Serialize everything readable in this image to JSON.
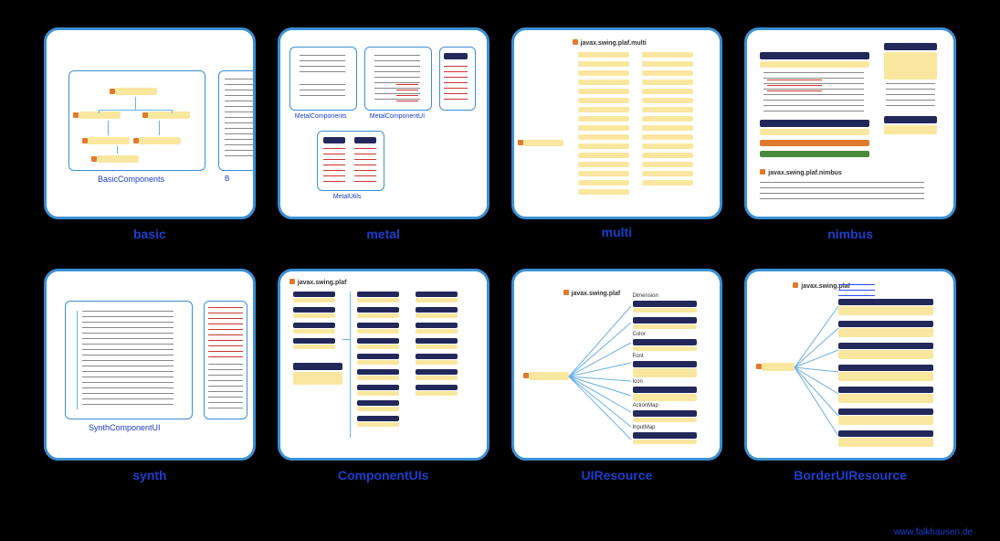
{
  "cards": [
    {
      "id": "basic",
      "label": "basic",
      "inner_label": "BasicComponents"
    },
    {
      "id": "metal",
      "label": "metal",
      "inner_labels": [
        "MetalComponents",
        "MetalComponentUI",
        "MetalUtils"
      ]
    },
    {
      "id": "multi",
      "label": "multi",
      "package": "javax.swing.plaf.multi"
    },
    {
      "id": "nimbus",
      "label": "nimbus",
      "package": "javax.swing.plaf.nimbus"
    },
    {
      "id": "synth",
      "label": "synth",
      "inner_label": "SynthComponentUI"
    },
    {
      "id": "componentuis",
      "label": "ComponentUIs",
      "package": "javax.swing.plaf"
    },
    {
      "id": "uiresource",
      "label": "UIResource",
      "package": "javax.swing.plaf",
      "categories": [
        "Dimension",
        "Color",
        "Font",
        "Icon",
        "ActionMap",
        "InputMap"
      ]
    },
    {
      "id": "borderuiresource",
      "label": "BorderUIResource",
      "package": "javax.swing.plaf"
    }
  ],
  "footer": "www.falkhausen.de"
}
